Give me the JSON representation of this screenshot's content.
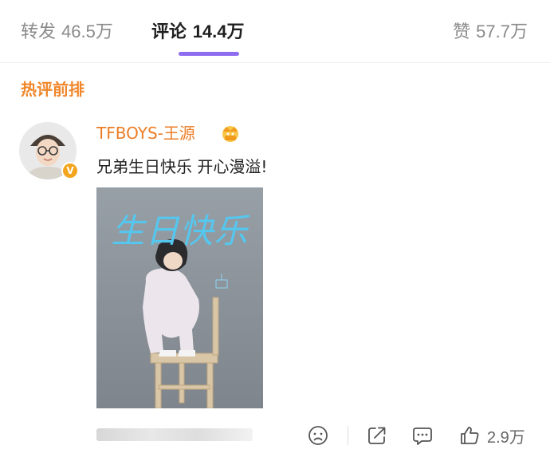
{
  "tabs": {
    "repost": {
      "label": "转发",
      "count": "46.5万"
    },
    "comment": {
      "label": "评论",
      "count": "14.4万"
    },
    "like": {
      "label": "赞",
      "count": "57.7万"
    },
    "active": "comment"
  },
  "hot_comments": {
    "title": "热评前排"
  },
  "comment": {
    "username": "TFBOYS-王源",
    "text": "兄弟生日快乐 开心漫溢!",
    "image_caption": "生日快乐",
    "actions": {
      "like_count": "2.9万"
    }
  },
  "icons": {
    "verified_badge": "vip-badge-icon",
    "crown": "crown-badge-icon",
    "dislike": "sad-face-icon",
    "share": "share-icon",
    "reply": "comment-bubble-icon",
    "like": "thumbs-up-icon"
  },
  "colors": {
    "accent": "#8e6cf0",
    "username": "#ec7d25",
    "section_title": "#f0862a",
    "badge": "#f3a51d",
    "photo_text": "#55c7ef"
  }
}
